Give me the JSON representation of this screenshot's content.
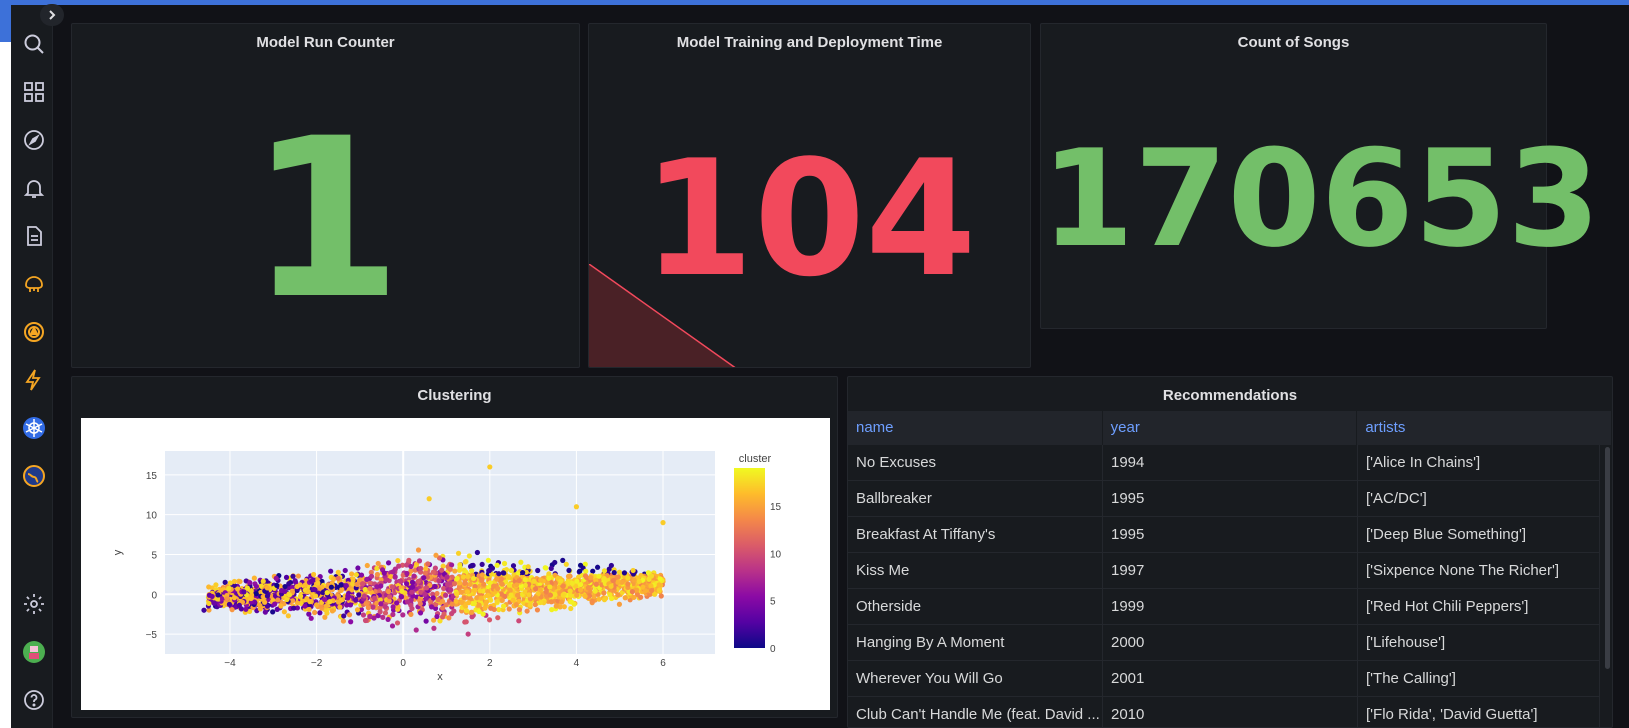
{
  "sidebar": {
    "items": [
      {
        "icon": "search-icon"
      },
      {
        "icon": "dashboards-icon"
      },
      {
        "icon": "explore-icon"
      },
      {
        "icon": "alerting-icon"
      },
      {
        "icon": "reports-icon"
      },
      {
        "icon": "brain-plugin-icon"
      },
      {
        "icon": "ring-plugin-icon"
      },
      {
        "icon": "bolt-plugin-icon"
      },
      {
        "icon": "kubernetes-icon"
      },
      {
        "icon": "globe-plugin-icon"
      }
    ],
    "bottom": [
      {
        "icon": "gear-icon"
      },
      {
        "icon": "avatar-icon"
      },
      {
        "icon": "help-icon"
      }
    ]
  },
  "panels": {
    "run_counter": {
      "title": "Model Run Counter",
      "value": "1",
      "color": "#73bf69"
    },
    "training_time": {
      "title": "Model Training and Deployment Time",
      "value": "104",
      "color": "#f2495c"
    },
    "songs_count": {
      "title": "Count of Songs",
      "value": "170653",
      "color": "#73bf69"
    },
    "clustering": {
      "title": "Clustering"
    },
    "recommendations": {
      "title": "Recommendations",
      "columns": [
        "name",
        "year",
        "artists"
      ],
      "rows": [
        [
          "No Excuses",
          "1994",
          "['Alice In Chains']"
        ],
        [
          "Ballbreaker",
          "1995",
          "['AC/DC']"
        ],
        [
          "Breakfast At Tiffany's",
          "1995",
          "['Deep Blue Something']"
        ],
        [
          "Kiss Me",
          "1997",
          "['Sixpence None The Richer']"
        ],
        [
          "Otherside",
          "1999",
          "['Red Hot Chili Peppers']"
        ],
        [
          "Hanging By A Moment",
          "2000",
          "['Lifehouse']"
        ],
        [
          "Wherever You Will Go",
          "2001",
          "['The Calling']"
        ],
        [
          "Club Can't Handle Me (feat. David ...",
          "2010",
          "['Flo Rida', 'David Guetta']"
        ]
      ]
    }
  },
  "chart_data": {
    "type": "scatter",
    "title": "",
    "xlabel": "x",
    "ylabel": "y",
    "xlim": [
      -5.5,
      7.2
    ],
    "ylim": [
      -7.5,
      18
    ],
    "xticks": [
      -4,
      -2,
      0,
      2,
      4,
      6
    ],
    "yticks": [
      -5,
      0,
      5,
      10,
      15
    ],
    "colorbar": {
      "title": "cluster",
      "range": [
        0,
        19
      ],
      "ticks": [
        0,
        5,
        10,
        15
      ],
      "colorscale": "plasma"
    },
    "grid": true,
    "points_sample": [
      {
        "x": -4.6,
        "y": -2,
        "cluster": 2
      },
      {
        "x": -3.2,
        "y": -1,
        "cluster": 16
      },
      {
        "x": -1.5,
        "y": 2,
        "cluster": 12
      },
      {
        "x": 0.5,
        "y": 0,
        "cluster": 8
      },
      {
        "x": 1.5,
        "y": -5,
        "cluster": 9
      },
      {
        "x": 2.5,
        "y": 3,
        "cluster": 18
      },
      {
        "x": 3.5,
        "y": 4,
        "cluster": 1
      },
      {
        "x": 4.8,
        "y": 1,
        "cluster": 17
      },
      {
        "x": 2.0,
        "y": 16,
        "cluster": 17
      },
      {
        "x": 6.0,
        "y": 9,
        "cluster": 17
      },
      {
        "x": 0.6,
        "y": 12,
        "cluster": 17
      },
      {
        "x": 4.0,
        "y": 11,
        "cluster": 17
      }
    ]
  }
}
